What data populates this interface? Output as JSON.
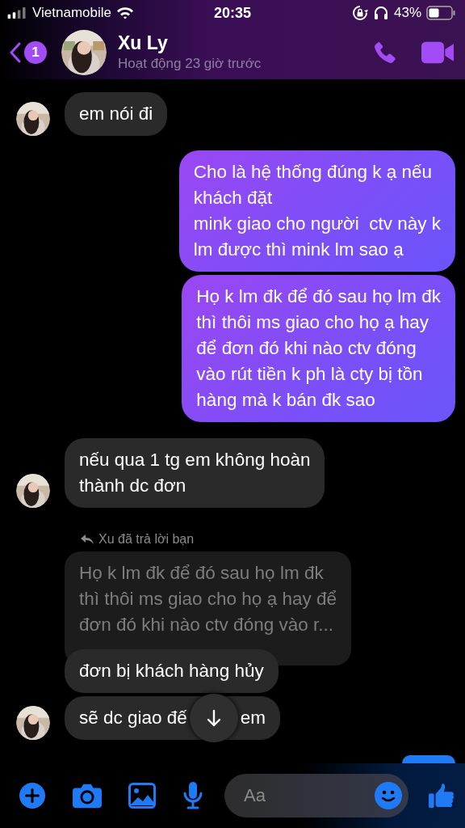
{
  "status_bar": {
    "carrier": "Vietnamobile",
    "time": "20:35",
    "battery": "43%"
  },
  "header": {
    "back_badge": "1",
    "name": "Xu Ly",
    "activity": "Hoạt động 23 giờ trước"
  },
  "messages": [
    {
      "kind": "received",
      "text": "em nói đi",
      "show_avatar": true
    },
    {
      "kind": "sent",
      "text": "Cho là hệ thống đúng k ạ nếu\nkhách đặt\nmink giao cho người  ctv này k\nlm được thì mink lm sao ạ"
    },
    {
      "kind": "sent",
      "text": "Họ k lm đk để đó sau họ lm đk\nthì thôi ms giao cho họ ạ hay\nđể đơn đó khi nào ctv đóng\nvào rút tiền k ph là cty bị tồn\nhàng mà k bán đk sao"
    },
    {
      "kind": "received",
      "text": "nếu qua 1 tg em không hoàn\nthành dc đơn",
      "show_avatar": true
    },
    {
      "kind": "reply_quote",
      "label": "Xu đã trả lời bạn",
      "text": "Họ k lm đk để đó sau họ lm đk\nthì thôi ms giao cho họ ạ hay để\nđơn đó khi nào ctv đóng vào r..."
    },
    {
      "kind": "received",
      "text": "đơn bị khách hàng hủy",
      "show_avatar": false
    },
    {
      "kind": "received_covered",
      "text_before": "sẽ dc giao đế",
      "text_after": "em",
      "show_avatar": true
    }
  ],
  "composer": {
    "placeholder": "Aa"
  }
}
